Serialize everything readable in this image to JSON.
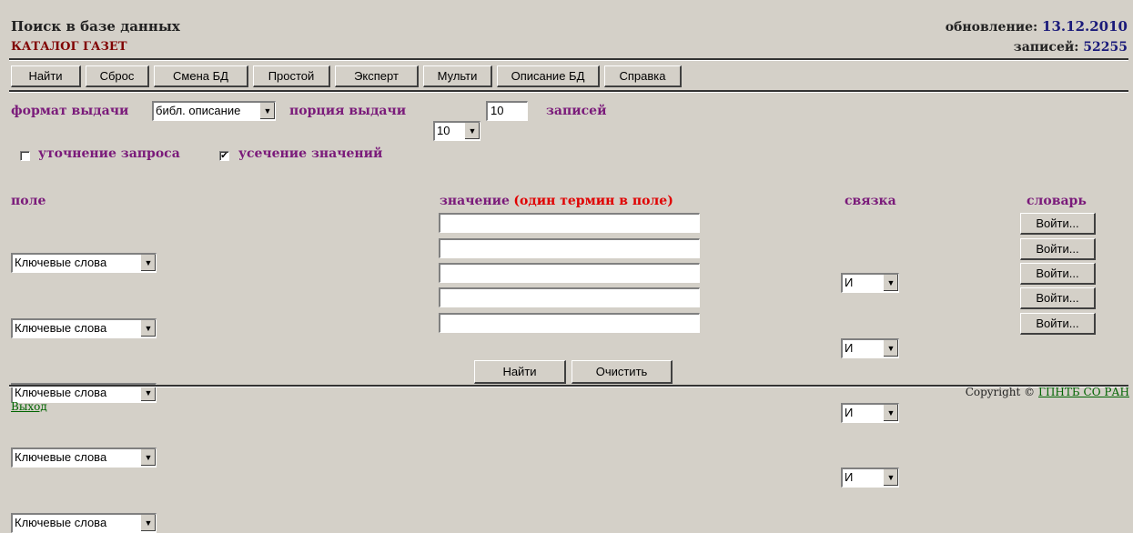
{
  "header": {
    "title": "Поиск в базе данных",
    "subtitle": "КАТАЛОГ ГАЗЕТ",
    "update_label": "обновление:",
    "update_value": "13.12.2010",
    "records_label": "записей:",
    "records_value": "52255"
  },
  "toolbar": {
    "buttons": [
      "Найти",
      "Сброс",
      "Смена БД",
      "Простой",
      "Эксперт",
      "Мульти",
      "Описание БД",
      "Справка"
    ]
  },
  "options": {
    "format_label": "формат выдачи",
    "format_value": "библ. описание",
    "portion_label": "порция выдачи",
    "portion_value": "10",
    "portion_input": "10",
    "records_suffix": "записей",
    "refine_label": "уточнение запроса",
    "refine_checked": false,
    "truncate_label": "усечение значений",
    "truncate_checked": true,
    "check_mark": "✔"
  },
  "table": {
    "headers": {
      "field": "поле",
      "value": "значение",
      "value_note": "(один термин в поле)",
      "link": "связка",
      "dict": "словарь"
    },
    "rows": [
      {
        "field": "Ключевые слова",
        "value": "",
        "link": "И",
        "dict": "Войти..."
      },
      {
        "field": "Ключевые слова",
        "value": "",
        "link": "И",
        "dict": "Войти..."
      },
      {
        "field": "Ключевые слова",
        "value": "",
        "link": "И",
        "dict": "Войти..."
      },
      {
        "field": "Ключевые слова",
        "value": "",
        "link": "И",
        "dict": "Войти..."
      },
      {
        "field": "Ключевые слова",
        "value": "",
        "link": null,
        "dict": "Войти..."
      }
    ]
  },
  "bottom": {
    "search": "Найти",
    "clear": "Очистить"
  },
  "footer": {
    "exit": "Выход",
    "copyright_prefix": "Copyright ©",
    "copyright_link": "ГПНТБ СО РАН"
  },
  "icons": {
    "dropdown": "dropdown-arrow-icon",
    "checkbox": "checkbox-icon"
  },
  "colors": {
    "background": "#d4d0c8",
    "label_purple": "#7a1a7a",
    "note_red": "#e00000",
    "subtitle_dark_red": "#800000",
    "link_green": "#006400"
  }
}
